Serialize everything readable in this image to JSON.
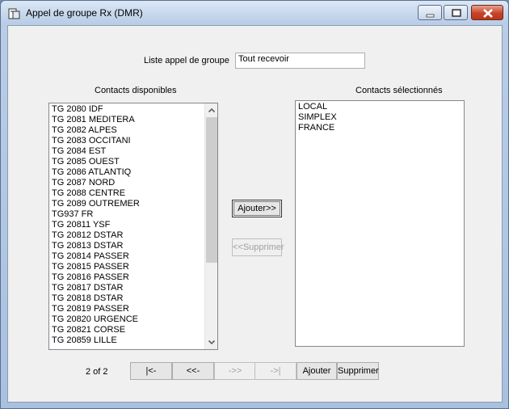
{
  "window": {
    "title": "Appel de groupe Rx (DMR)"
  },
  "group_list": {
    "label": "Liste appel de groupe",
    "value": "Tout recevoir"
  },
  "available": {
    "label": "Contacts disponibles",
    "items": [
      "TG 2080 IDF",
      "TG 2081 MEDITERA",
      "TG 2082 ALPES",
      "TG 2083 OCCITANI",
      "TG 2084 EST",
      "TG 2085 OUEST",
      "TG 2086 ATLANTIQ",
      "TG 2087 NORD",
      "TG 2088 CENTRE",
      "TG 2089 OUTREMER",
      "TG937 FR",
      "TG 20811 YSF",
      "TG 20812 DSTAR",
      "TG 20813 DSTAR",
      "TG 20814 PASSER",
      "TG 20815 PASSER",
      "TG 20816 PASSER",
      "TG 20817 DSTAR",
      "TG 20818 DSTAR",
      "TG 20819  PASSER",
      "TG 20820 URGENCE",
      "TG 20821 CORSE",
      "TG 20859 LILLE"
    ]
  },
  "selected": {
    "label": "Contacts sélectionnés",
    "items": [
      "LOCAL",
      "SIMPLEX",
      "FRANCE"
    ]
  },
  "buttons": {
    "add": "Ajouter>>",
    "remove": "<<Supprimer"
  },
  "pager": {
    "status": "2 of 2",
    "first": "|<-",
    "prev": "<<-",
    "next": "->>",
    "last": "->|",
    "add": "Ajouter",
    "delete": "Supprimer"
  }
}
